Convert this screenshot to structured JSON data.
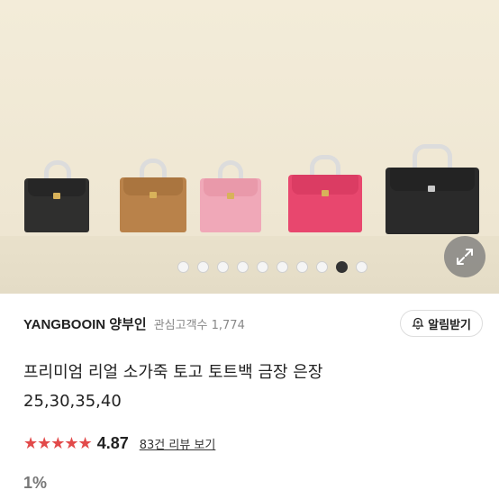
{
  "gallery": {
    "image_alt": "product-photo-bags",
    "bags": [
      {
        "color": "#2f2f2e"
      },
      {
        "color": "#b9824a"
      },
      {
        "color": "#f0a8b8"
      },
      {
        "color": "#e8476e"
      },
      {
        "color": "#2a2a2a"
      }
    ],
    "page_count": 10,
    "active_index": 8,
    "expand_icon": "expand-arrows-icon"
  },
  "seller": {
    "name": "YANGBOOIN 양부인",
    "followers_label": "관심고객수 1,774",
    "alert_label": "알림받기",
    "alert_icon": "bell-plus-icon"
  },
  "product": {
    "title_line1": "프리미엄 리얼 소가죽 토고 토트백 금장 은장",
    "title_line2": "25,30,35,40"
  },
  "rating": {
    "stars": "★★★★★",
    "value": "4.87",
    "review_link": "83건 리뷰 보기",
    "star_color": "#e24a4a"
  },
  "price": {
    "discount": "1%"
  }
}
